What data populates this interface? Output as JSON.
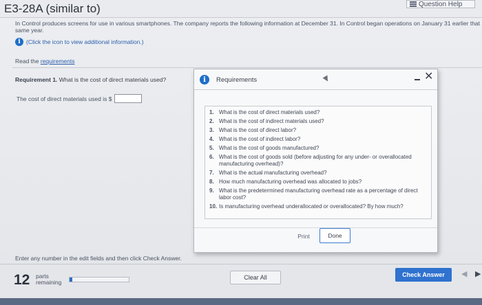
{
  "header": {
    "title": "E3-28A (similar to)",
    "help_label": "Question Help"
  },
  "intro": {
    "text": "In Control produces screens for use in various smartphones. The company reports the following information at December 31. In Control began operations on January 31 earlier that same year.",
    "info_link": "(Click the icon to view additional information.)"
  },
  "read_requirements": {
    "prefix": "Read the ",
    "link": "requirements"
  },
  "question": {
    "label": "Requirement 1.",
    "text": "What is the cost of direct materials used?",
    "answer_prefix": "The cost of direct materials used is $",
    "answer_value": ""
  },
  "modal": {
    "title": "Requirements",
    "items": [
      {
        "num": "1.",
        "text": "What is the cost of direct materials used?"
      },
      {
        "num": "2.",
        "text": "What is the cost of indirect materials used?"
      },
      {
        "num": "3.",
        "text": "What is the cost of direct labor?"
      },
      {
        "num": "4.",
        "text": "What is the cost of indirect labor?"
      },
      {
        "num": "5.",
        "text": "What is the cost of goods manufactured?"
      },
      {
        "num": "6.",
        "text": "What is the cost of goods sold (before adjusting for any under- or overallocated manufacturing overhead)?"
      },
      {
        "num": "7.",
        "text": "What is the actual manufacturing overhead?"
      },
      {
        "num": "8.",
        "text": "How much manufacturing overhead was allocated to jobs?"
      },
      {
        "num": "9.",
        "text": "What is the predetermined manufacturing overhead rate as a percentage of direct labor cost?"
      },
      {
        "num": "10.",
        "text": "Is manufacturing overhead underallocated or overallocated? By how much?"
      }
    ],
    "print_label": "Print",
    "done_label": "Done"
  },
  "footer": {
    "note": "Enter any number in the edit fields and then click Check Answer.",
    "parts_count": "12",
    "parts_label_1": "parts",
    "parts_label_2": "remaining",
    "progress": 0.05,
    "clear_label": "Clear All",
    "check_label": "Check Answer"
  },
  "colors": {
    "accent": "#2f72cf",
    "link": "#2b5fae"
  }
}
